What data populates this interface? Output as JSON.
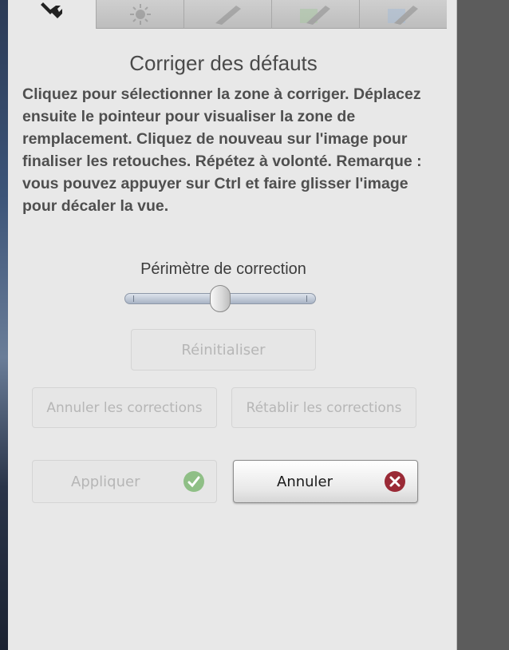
{
  "title": "Corriger des défauts",
  "description": "Cliquez pour sélectionner la zone à corriger. Déplacez ensuite le pointeur pour visualiser la zone de remplacement. Cliquez de nouveau sur l'image pour finaliser les retouches. Répétez à volonté. Remarque : vous pouvez appuyer sur Ctrl et faire glisser l'image pour décaler la vue.",
  "tabs": [
    {
      "icon": "wrench-icon",
      "active": true
    },
    {
      "icon": "brightness-icon",
      "active": false
    },
    {
      "icon": "brush-icon",
      "active": false
    },
    {
      "icon": "green-brush-icon",
      "active": false
    },
    {
      "icon": "blue-brush-icon",
      "active": false
    }
  ],
  "slider": {
    "label": "Périmètre de correction",
    "value_fraction": 0.5
  },
  "buttons": {
    "reset": "Réinitialiser",
    "undo": "Annuler les corrections",
    "redo": "Rétablir les corrections",
    "apply": "Appliquer",
    "cancel": "Annuler"
  },
  "colors": {
    "apply_check": "#8fbf86",
    "cancel_x": "#9a2a36"
  }
}
